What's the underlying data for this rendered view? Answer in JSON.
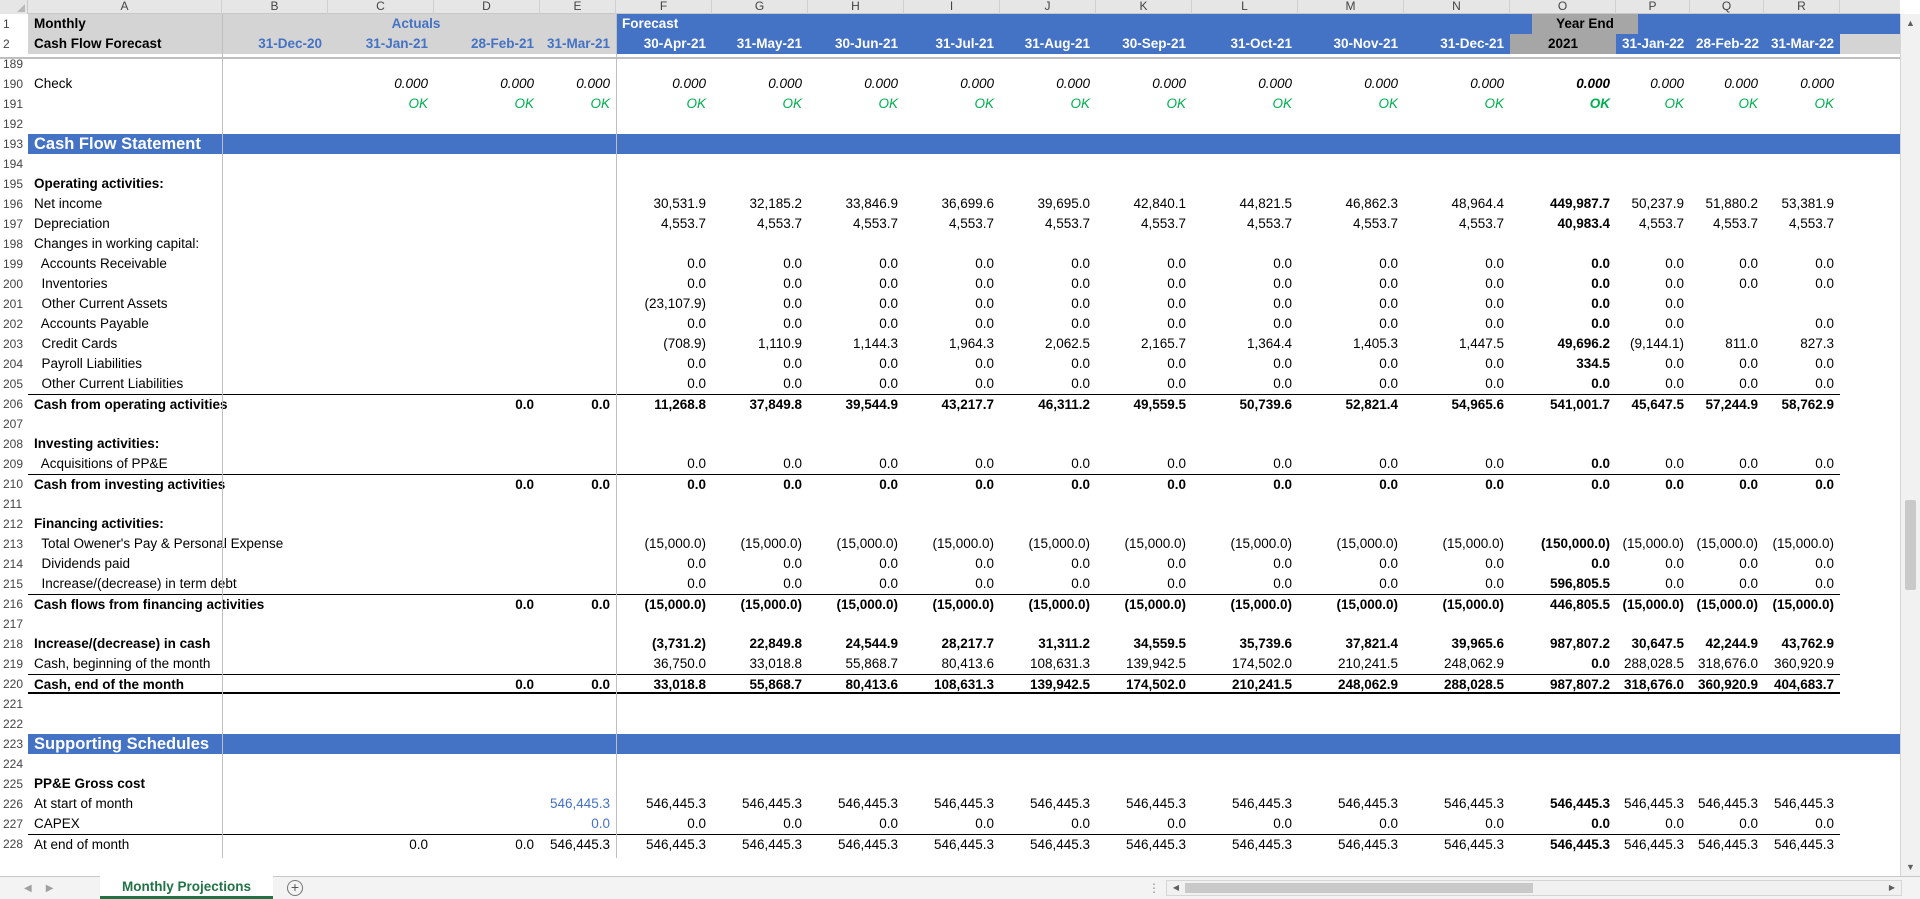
{
  "columns": [
    "A",
    "B",
    "C",
    "D",
    "E",
    "F",
    "G",
    "H",
    "I",
    "J",
    "K",
    "L",
    "M",
    "N",
    "O",
    "P",
    "Q",
    "R"
  ],
  "header": {
    "row1": {
      "num": "1",
      "a": "Monthly",
      "actuals": "Actuals",
      "forecast": "Forecast",
      "year_end": "Year End"
    },
    "row2": {
      "num": "2",
      "a": "Cash Flow Forecast",
      "dates": [
        "31-Dec-20",
        "31-Jan-21",
        "28-Feb-21",
        "31-Mar-21",
        "30-Apr-21",
        "31-May-21",
        "30-Jun-21",
        "31-Jul-21",
        "31-Aug-21",
        "30-Sep-21",
        "31-Oct-21",
        "30-Nov-21",
        "31-Dec-21",
        "2021",
        "31-Jan-22",
        "28-Feb-22",
        "31-Mar-22"
      ]
    }
  },
  "rows": [
    {
      "num": "189",
      "label": "",
      "vals": []
    },
    {
      "num": "190",
      "label": "Check",
      "style": "check",
      "vals": [
        "",
        "0.000",
        "0.000",
        "0.000",
        "0.000",
        "0.000",
        "0.000",
        "0.000",
        "0.000",
        "0.000",
        "0.000",
        "0.000",
        "0.000",
        "0.000",
        "0.000",
        "0.000",
        "0.000"
      ]
    },
    {
      "num": "191",
      "label": "",
      "style": "ok",
      "vals": [
        "",
        "OK",
        "OK",
        "OK",
        "OK",
        "OK",
        "OK",
        "OK",
        "OK",
        "OK",
        "OK",
        "OK",
        "OK",
        "OK",
        "OK",
        "OK",
        "OK"
      ]
    },
    {
      "num": "192",
      "label": "",
      "vals": []
    },
    {
      "num": "193",
      "label": "Cash Flow Statement",
      "style": "band",
      "vals": []
    },
    {
      "num": "194",
      "label": "",
      "vals": []
    },
    {
      "num": "195",
      "label": "Operating activities:",
      "style": "bold",
      "vals": []
    },
    {
      "num": "196",
      "label": "Net income",
      "vals": [
        "",
        "",
        "",
        "",
        "30,531.9",
        "32,185.2",
        "33,846.9",
        "36,699.6",
        "39,695.0",
        "42,840.1",
        "44,821.5",
        "46,862.3",
        "48,964.4",
        "449,987.7",
        "50,237.9",
        "51,880.2",
        "53,381.9"
      ]
    },
    {
      "num": "197",
      "label": "Depreciation",
      "vals": [
        "",
        "",
        "",
        "",
        "4,553.7",
        "4,553.7",
        "4,553.7",
        "4,553.7",
        "4,553.7",
        "4,553.7",
        "4,553.7",
        "4,553.7",
        "4,553.7",
        "40,983.4",
        "4,553.7",
        "4,553.7",
        "4,553.7"
      ]
    },
    {
      "num": "198",
      "label": "Changes in working capital:",
      "vals": []
    },
    {
      "num": "199",
      "label": "  Accounts Receivable",
      "vals": [
        "",
        "",
        "",
        "",
        "0.0",
        "0.0",
        "0.0",
        "0.0",
        "0.0",
        "0.0",
        "0.0",
        "0.0",
        "0.0",
        "0.0",
        "0.0",
        "0.0",
        "0.0"
      ]
    },
    {
      "num": "200",
      "label": "  Inventories",
      "vals": [
        "",
        "",
        "",
        "",
        "0.0",
        "0.0",
        "0.0",
        "0.0",
        "0.0",
        "0.0",
        "0.0",
        "0.0",
        "0.0",
        "0.0",
        "0.0",
        "0.0",
        "0.0"
      ]
    },
    {
      "num": "201",
      "label": "  Other Current Assets",
      "vals": [
        "",
        "",
        "",
        "",
        "(23,107.9)",
        "0.0",
        "0.0",
        "0.0",
        "0.0",
        "0.0",
        "0.0",
        "0.0",
        "0.0",
        "0.0",
        "0.0",
        "",
        ""
      ]
    },
    {
      "num": "202",
      "label": "  Accounts Payable",
      "vals": [
        "",
        "",
        "",
        "",
        "0.0",
        "0.0",
        "0.0",
        "0.0",
        "0.0",
        "0.0",
        "0.0",
        "0.0",
        "0.0",
        "0.0",
        "0.0",
        "",
        "0.0"
      ]
    },
    {
      "num": "203",
      "label": "  Credit Cards",
      "vals": [
        "",
        "",
        "",
        "",
        "(708.9)",
        "1,110.9",
        "1,144.3",
        "1,964.3",
        "2,062.5",
        "2,165.7",
        "1,364.4",
        "1,405.3",
        "1,447.5",
        "49,696.2",
        "(9,144.1)",
        "811.0",
        "827.3"
      ]
    },
    {
      "num": "204",
      "label": "  Payroll Liabilities",
      "vals": [
        "",
        "",
        "",
        "",
        "0.0",
        "0.0",
        "0.0",
        "0.0",
        "0.0",
        "0.0",
        "0.0",
        "0.0",
        "0.0",
        "334.5",
        "0.0",
        "0.0",
        "0.0"
      ]
    },
    {
      "num": "205",
      "label": "  Other Current Liabilities",
      "vals": [
        "",
        "",
        "",
        "",
        "0.0",
        "0.0",
        "0.0",
        "0.0",
        "0.0",
        "0.0",
        "0.0",
        "0.0",
        "0.0",
        "0.0",
        "0.0",
        "0.0",
        "0.0"
      ]
    },
    {
      "num": "206",
      "label": "Cash from operating activities",
      "style": "total",
      "vals": [
        "",
        "",
        "0.0",
        "0.0",
        "11,268.8",
        "37,849.8",
        "39,544.9",
        "43,217.7",
        "46,311.2",
        "49,559.5",
        "50,739.6",
        "52,821.4",
        "54,965.6",
        "541,001.7",
        "45,647.5",
        "57,244.9",
        "58,762.9"
      ]
    },
    {
      "num": "207",
      "label": "",
      "vals": []
    },
    {
      "num": "208",
      "label": "Investing activities:",
      "style": "bold",
      "vals": []
    },
    {
      "num": "209",
      "label": "  Acquisitions of PP&E",
      "vals": [
        "",
        "",
        "",
        "",
        "0.0",
        "0.0",
        "0.0",
        "0.0",
        "0.0",
        "0.0",
        "0.0",
        "0.0",
        "0.0",
        "0.0",
        "0.0",
        "0.0",
        "0.0"
      ]
    },
    {
      "num": "210",
      "label": "Cash from investing activities",
      "style": "total",
      "vals": [
        "",
        "",
        "0.0",
        "0.0",
        "0.0",
        "0.0",
        "0.0",
        "0.0",
        "0.0",
        "0.0",
        "0.0",
        "0.0",
        "0.0",
        "0.0",
        "0.0",
        "0.0",
        "0.0"
      ]
    },
    {
      "num": "211",
      "label": "",
      "vals": []
    },
    {
      "num": "212",
      "label": "Financing activities:",
      "style": "bold",
      "vals": []
    },
    {
      "num": "213",
      "label": "  Total Owener's Pay & Personal Expense",
      "vals": [
        "",
        "",
        "",
        "",
        "(15,000.0)",
        "(15,000.0)",
        "(15,000.0)",
        "(15,000.0)",
        "(15,000.0)",
        "(15,000.0)",
        "(15,000.0)",
        "(15,000.0)",
        "(15,000.0)",
        "(150,000.0)",
        "(15,000.0)",
        "(15,000.0)",
        "(15,000.0)"
      ]
    },
    {
      "num": "214",
      "label": "  Dividends paid",
      "vals": [
        "",
        "",
        "",
        "",
        "0.0",
        "0.0",
        "0.0",
        "0.0",
        "0.0",
        "0.0",
        "0.0",
        "0.0",
        "0.0",
        "0.0",
        "0.0",
        "0.0",
        "0.0"
      ]
    },
    {
      "num": "215",
      "label": "  Increase/(decrease) in term debt",
      "vals": [
        "",
        "",
        "",
        "",
        "0.0",
        "0.0",
        "0.0",
        "0.0",
        "0.0",
        "0.0",
        "0.0",
        "0.0",
        "0.0",
        "596,805.5",
        "0.0",
        "0.0",
        "0.0"
      ]
    },
    {
      "num": "216",
      "label": "Cash flows from financing activities",
      "style": "total",
      "vals": [
        "",
        "",
        "0.0",
        "0.0",
        "(15,000.0)",
        "(15,000.0)",
        "(15,000.0)",
        "(15,000.0)",
        "(15,000.0)",
        "(15,000.0)",
        "(15,000.0)",
        "(15,000.0)",
        "(15,000.0)",
        "446,805.5",
        "(15,000.0)",
        "(15,000.0)",
        "(15,000.0)"
      ]
    },
    {
      "num": "217",
      "label": "",
      "vals": []
    },
    {
      "num": "218",
      "label": "Increase/(decrease) in cash",
      "style": "bold",
      "vals": [
        "",
        "",
        "",
        "",
        "(3,731.2)",
        "22,849.8",
        "24,544.9",
        "28,217.7",
        "31,311.2",
        "34,559.5",
        "35,739.6",
        "37,821.4",
        "39,965.6",
        "987,807.2",
        "30,647.5",
        "42,244.9",
        "43,762.9"
      ]
    },
    {
      "num": "219",
      "label": "Cash, beginning of the month",
      "vals": [
        "",
        "",
        "",
        "",
        "36,750.0",
        "33,018.8",
        "55,868.7",
        "80,413.6",
        "108,631.3",
        "139,942.5",
        "174,502.0",
        "210,241.5",
        "248,062.9",
        "0.0",
        "288,028.5",
        "318,676.0",
        "360,920.9"
      ]
    },
    {
      "num": "220",
      "label": "Cash, end of the month",
      "style": "total2",
      "vals": [
        "",
        "",
        "0.0",
        "0.0",
        "33,018.8",
        "55,868.7",
        "80,413.6",
        "108,631.3",
        "139,942.5",
        "174,502.0",
        "210,241.5",
        "248,062.9",
        "288,028.5",
        "987,807.2",
        "318,676.0",
        "360,920.9",
        "404,683.7"
      ]
    },
    {
      "num": "221",
      "label": "",
      "vals": []
    },
    {
      "num": "222",
      "label": "",
      "vals": []
    },
    {
      "num": "223",
      "label": "Supporting Schedules",
      "style": "band",
      "vals": []
    },
    {
      "num": "224",
      "label": "",
      "vals": []
    },
    {
      "num": "225",
      "label": "PP&E Gross cost",
      "style": "bold",
      "vals": []
    },
    {
      "num": "226",
      "label": "At start of month",
      "style": "ppe-start",
      "vals": [
        "",
        "",
        "",
        "546,445.3",
        "546,445.3",
        "546,445.3",
        "546,445.3",
        "546,445.3",
        "546,445.3",
        "546,445.3",
        "546,445.3",
        "546,445.3",
        "546,445.3",
        "546,445.3",
        "546,445.3",
        "546,445.3",
        "546,445.3"
      ]
    },
    {
      "num": "227",
      "label": "CAPEX",
      "style": "ppe-capex",
      "vals": [
        "",
        "",
        "",
        "0.0",
        "0.0",
        "0.0",
        "0.0",
        "0.0",
        "0.0",
        "0.0",
        "0.0",
        "0.0",
        "0.0",
        "0.0",
        "0.0",
        "0.0",
        "0.0"
      ]
    },
    {
      "num": "228",
      "label": "At end of month",
      "style": "ppe-end",
      "vals": [
        "",
        "0.0",
        "0.0",
        "546,445.3",
        "546,445.3",
        "546,445.3",
        "546,445.3",
        "546,445.3",
        "546,445.3",
        "546,445.3",
        "546,445.3",
        "546,445.3",
        "546,445.3",
        "546,445.3",
        "546,445.3",
        "546,445.3",
        "546,445.3"
      ]
    }
  ],
  "sheet_tabs": [
    "Monthly Projections"
  ],
  "colors": {
    "accent": "#4472c4",
    "ok_green": "#00b050",
    "excel_green": "#217346"
  }
}
